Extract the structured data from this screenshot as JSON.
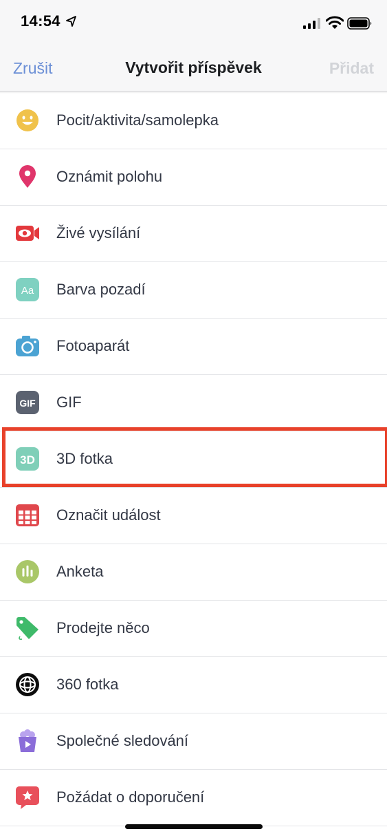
{
  "status_bar": {
    "time": "14:54"
  },
  "nav": {
    "cancel": "Zrušit",
    "title": "Vytvořit příspěvek",
    "add": "Přidat"
  },
  "menu": {
    "items": [
      {
        "label": "Pocit/aktivita/samolepka",
        "icon": "smiley-icon",
        "color": "#f0c24b"
      },
      {
        "label": "Oznámit polohu",
        "icon": "location-pin-icon",
        "color": "#e0356b"
      },
      {
        "label": "Živé vysílání",
        "icon": "live-video-icon",
        "color": "#e3393d"
      },
      {
        "label": "Barva pozadí",
        "icon": "text-background-icon",
        "color": "#7fd1c1"
      },
      {
        "label": "Fotoaparát",
        "icon": "camera-icon",
        "color": "#4ba3d3"
      },
      {
        "label": "GIF",
        "icon": "gif-icon",
        "color": "#5b6270"
      },
      {
        "label": "3D fotka",
        "icon": "3d-photo-icon",
        "color": "#7fcfb8"
      },
      {
        "label": "Označit událost",
        "icon": "calendar-icon",
        "color": "#e0474c"
      },
      {
        "label": "Anketa",
        "icon": "poll-icon",
        "color": "#a9c768"
      },
      {
        "label": "Prodejte něco",
        "icon": "price-tag-icon",
        "color": "#3fba6a"
      },
      {
        "label": "360 fotka",
        "icon": "globe-360-icon",
        "color": "#0d0d0d"
      },
      {
        "label": "Společné sledování",
        "icon": "popcorn-icon",
        "color": "#8b6dd9"
      },
      {
        "label": "Požádat o doporučení",
        "icon": "recommendation-icon",
        "color": "#e8505b"
      }
    ],
    "highlighted_item": "3D fotka",
    "highlight_color": "#e8412a"
  }
}
